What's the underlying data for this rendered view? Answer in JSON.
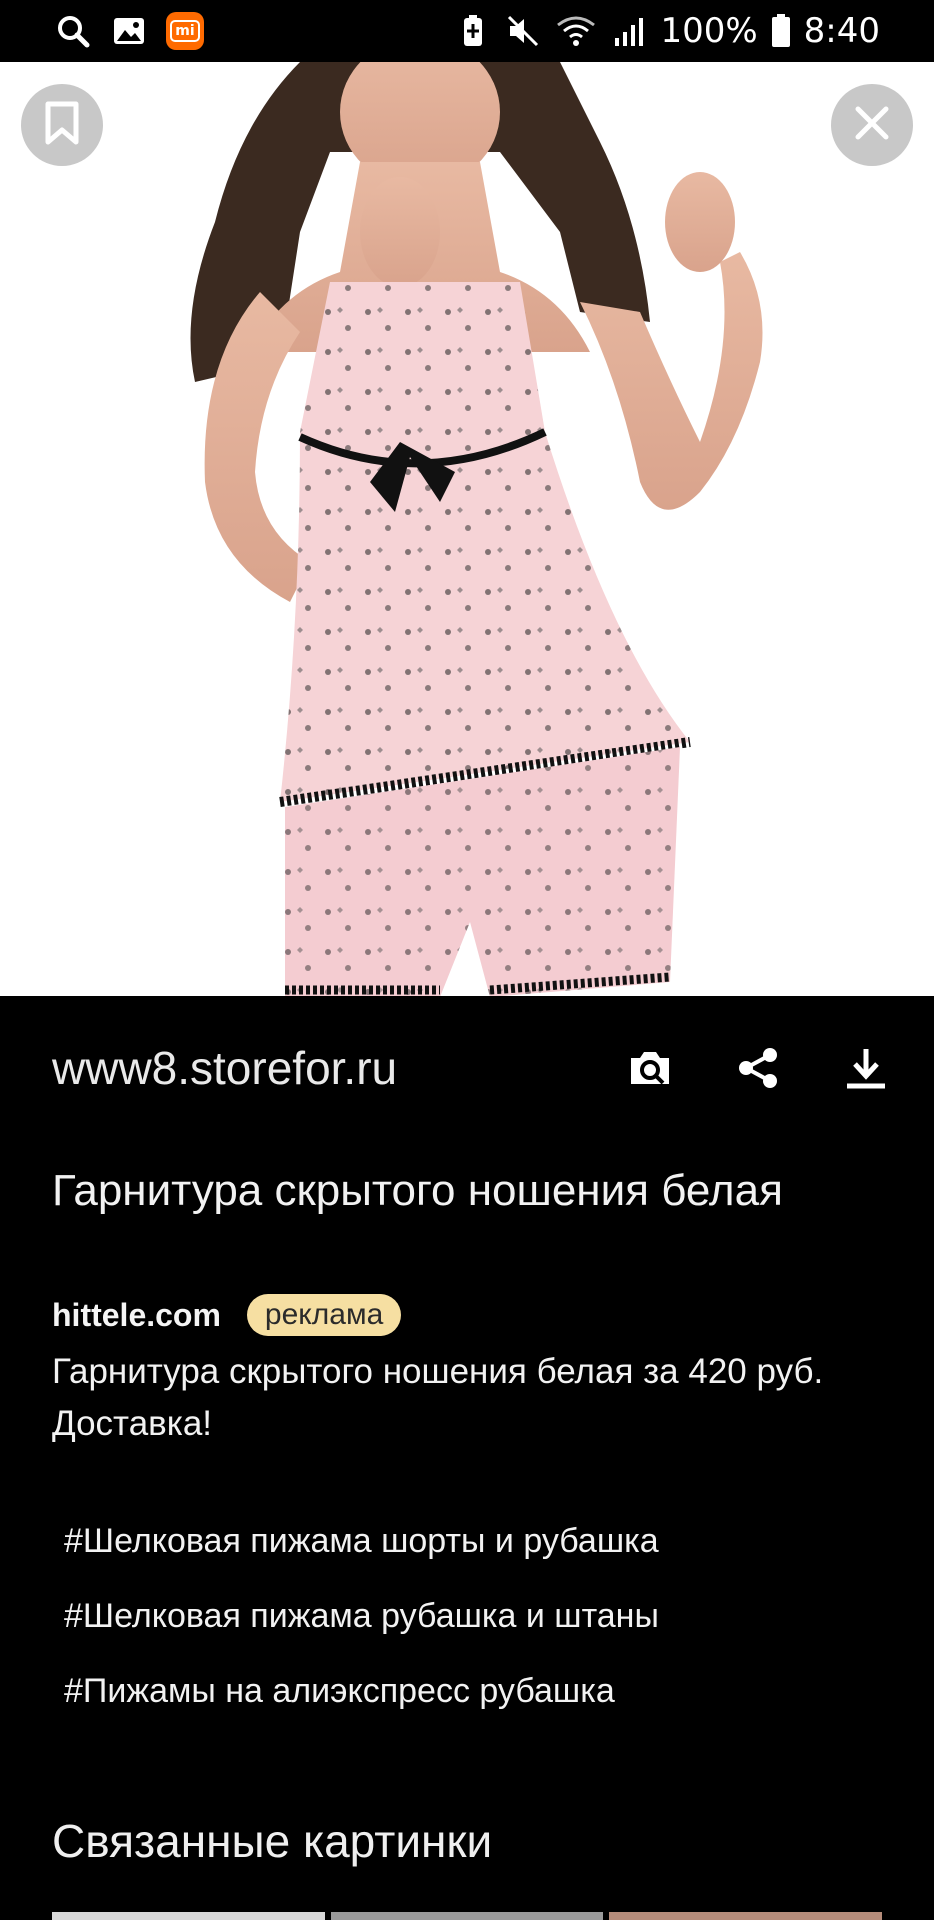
{
  "status_bar": {
    "battery": "100%",
    "time": "8:40",
    "icons": [
      "search-icon",
      "gallery-icon",
      "mi-app-icon",
      "battery-saver-icon",
      "mute-icon",
      "wifi-icon",
      "signal-icon",
      "battery-icon"
    ]
  },
  "image_viewer": {
    "image_subject": "pink satin pajama set with black lace trim",
    "bookmark_icon": "bookmark-icon",
    "close_icon": "close-icon"
  },
  "source": {
    "url": "www8.storefor.ru",
    "actions": [
      "search-by-image-icon",
      "share-icon",
      "download-icon"
    ]
  },
  "ad": {
    "title": "Гарнитура скрытого ношения белая",
    "domain": "hittele.com",
    "badge": "реклама",
    "description": "Гарнитура скрытого ношения белая за 420 руб. Доставка!"
  },
  "tags": [
    "#Шелковая пижама шорты и рубашка",
    "#Шелковая пижама рубашка и штаны",
    "#Пижамы на алиэкспресс рубашка"
  ],
  "related": {
    "title": "Связанные картинки"
  },
  "colors": {
    "background": "#000000",
    "ad_badge": "#f6dfa2",
    "mi_badge": "#ff6a00"
  }
}
